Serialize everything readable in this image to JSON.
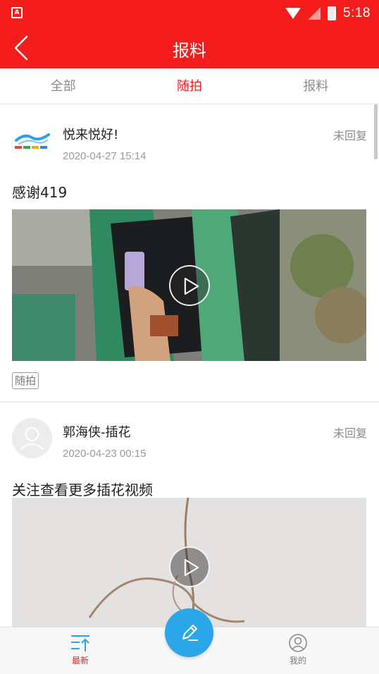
{
  "status_bar": {
    "app_icon_letter": "A",
    "time": "5:18"
  },
  "header": {
    "title": "报料",
    "back_icon": "chevron-left-icon"
  },
  "tabs": [
    {
      "label": "全部",
      "active": false
    },
    {
      "label": "随拍",
      "active": true
    },
    {
      "label": "报料",
      "active": false
    }
  ],
  "posts": [
    {
      "username": "悦来悦好!",
      "timestamp": "2020-04-27 15:14",
      "reply_status": "未回复",
      "text": "感谢419",
      "tag": "随拍"
    },
    {
      "username": "郭海侠-插花",
      "timestamp": "2020-04-23 00:15",
      "reply_status": "未回复",
      "text": "关注查看更多插花视频"
    }
  ],
  "bottom_nav": {
    "latest_label": "最新",
    "mine_label": "我的",
    "compose_icon": "pencil-icon"
  },
  "colors": {
    "brand_red": "#f51c1c",
    "fab_blue": "#29a7e8"
  }
}
